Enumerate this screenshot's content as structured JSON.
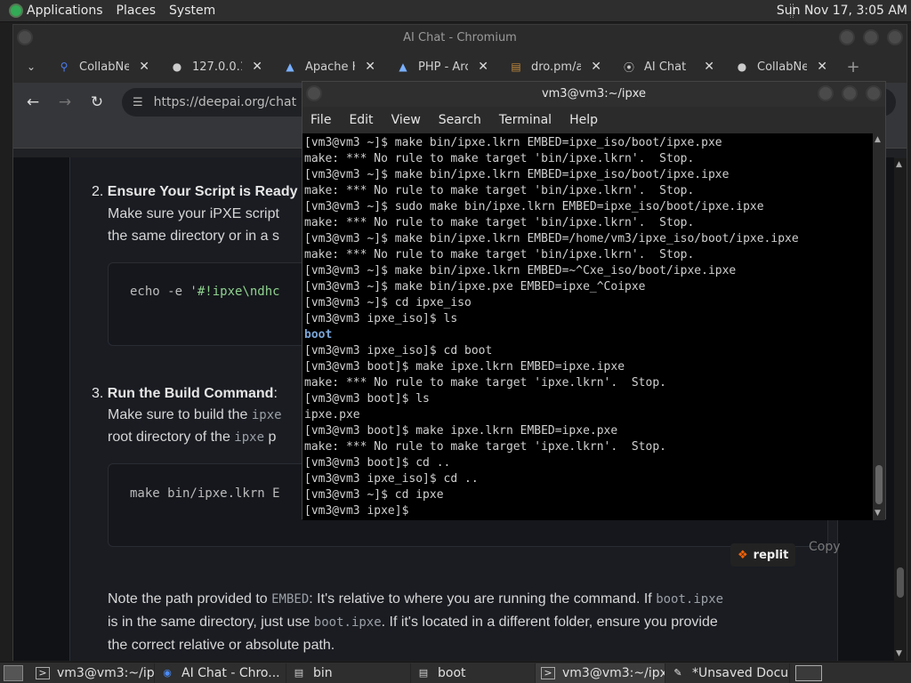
{
  "top_panel": {
    "menus": [
      "Applications",
      "Places",
      "System"
    ],
    "clock": "Sun Nov 17,  3:05 AM"
  },
  "chrome": {
    "title": "AI Chat - Chromium",
    "tabs": [
      {
        "label": "CollabNe",
        "icon": "search-icon",
        "color": "#4c7ef3"
      },
      {
        "label": "127.0.0.1",
        "icon": "globe-icon",
        "color": "#cccccc"
      },
      {
        "label": "Apache H",
        "icon": "apache-icon",
        "color": "#7ab0ff"
      },
      {
        "label": "PHP - Arc",
        "icon": "apache-icon",
        "color": "#7ab0ff"
      },
      {
        "label": "dro.pm/a",
        "icon": "folder-icon",
        "color": "#c28a3c"
      },
      {
        "label": "AI Chat",
        "icon": "ai-icon",
        "color": "#dddddd"
      },
      {
        "label": "CollabNe",
        "icon": "globe-icon",
        "color": "#cccccc"
      }
    ],
    "url": "https://deepai.org/chat"
  },
  "page": {
    "step2_num": "2.",
    "step2_title": "Ensure Your Script is Ready",
    "step2_line1": "Make sure your iPXE script",
    "step2_line2": "the same directory or in a s",
    "code1_prefix": "echo -e '",
    "code1_green": "#!ipxe\\ndhc",
    "step3_num": "3.",
    "step3_title": "Run the Build Command",
    "step3_colon": ":",
    "step3_line1": "Make sure to build the",
    "step3_line1_code": "ipxe",
    "step3_line2": "root directory of the",
    "step3_line2_code": "ipxe",
    "step3_line2_tail": "p",
    "code2": "make bin/ipxe.lkrn E",
    "replit_label": "replit",
    "copy_label": "Copy",
    "note_a": "Note the path provided to ",
    "note_code1": "EMBED",
    "note_b": ": It's relative to where you are running the command. If ",
    "note_code2": "boot.ipxe",
    "note_c": "is in the same directory, just use ",
    "note_code3": "boot.ipxe",
    "note_d": ". If it's located in a different folder, ensure you provide",
    "note_e": "the correct relative or absolute path."
  },
  "terminal": {
    "title": "vm3@vm3:~/ipxe",
    "menus": [
      "File",
      "Edit",
      "View",
      "Search",
      "Terminal",
      "Help"
    ],
    "lines": [
      "[vm3@vm3 ~]$ make bin/ipxe.lkrn EMBED=ipxe_iso/boot/ipxe.pxe",
      "make: *** No rule to make target 'bin/ipxe.lkrn'.  Stop.",
      "[vm3@vm3 ~]$ make bin/ipxe.lkrn EMBED=ipxe_iso/boot/ipxe.ipxe",
      "make: *** No rule to make target 'bin/ipxe.lkrn'.  Stop.",
      "[vm3@vm3 ~]$ sudo make bin/ipxe.lkrn EMBED=ipxe_iso/boot/ipxe.ipxe",
      "make: *** No rule to make target 'bin/ipxe.lkrn'.  Stop.",
      "[vm3@vm3 ~]$ make bin/ipxe.lkrn EMBED=/home/vm3/ipxe_iso/boot/ipxe.ipxe",
      "make: *** No rule to make target 'bin/ipxe.lkrn'.  Stop.",
      "[vm3@vm3 ~]$ make bin/ipxe.lkrn EMBED=~^Cxe_iso/boot/ipxe.ipxe",
      "[vm3@vm3 ~]$ make bin/ipxe.pxe EMBED=ipxe_^Coipxe",
      "[vm3@vm3 ~]$ cd ipxe_iso",
      "[vm3@vm3 ipxe_iso]$ ls",
      "boot",
      "[vm3@vm3 ipxe_iso]$ cd boot",
      "[vm3@vm3 boot]$ make ipxe.lkrn EMBED=ipxe.ipxe",
      "make: *** No rule to make target 'ipxe.lkrn'.  Stop.",
      "[vm3@vm3 boot]$ ls",
      "ipxe.pxe",
      "[vm3@vm3 boot]$ make ipxe.lkrn EMBED=ipxe.pxe",
      "make: *** No rule to make target 'ipxe.lkrn'.  Stop.",
      "[vm3@vm3 boot]$ cd ..",
      "[vm3@vm3 ipxe_iso]$ cd ..",
      "[vm3@vm3 ~]$ cd ipxe",
      "[vm3@vm3 ipxe]$ "
    ]
  },
  "taskbar": {
    "items": [
      {
        "label": "vm3@vm3:~/ip...",
        "icon": "terminal-icon"
      },
      {
        "label": "AI Chat - Chro...",
        "icon": "chromium-icon"
      },
      {
        "label": "bin",
        "icon": "folder-icon"
      },
      {
        "label": "boot",
        "icon": "folder-icon"
      },
      {
        "label": "vm3@vm3:~/ipxe",
        "icon": "terminal-icon"
      },
      {
        "label": "*Unsaved Docu...",
        "icon": "text-editor-icon"
      }
    ]
  }
}
